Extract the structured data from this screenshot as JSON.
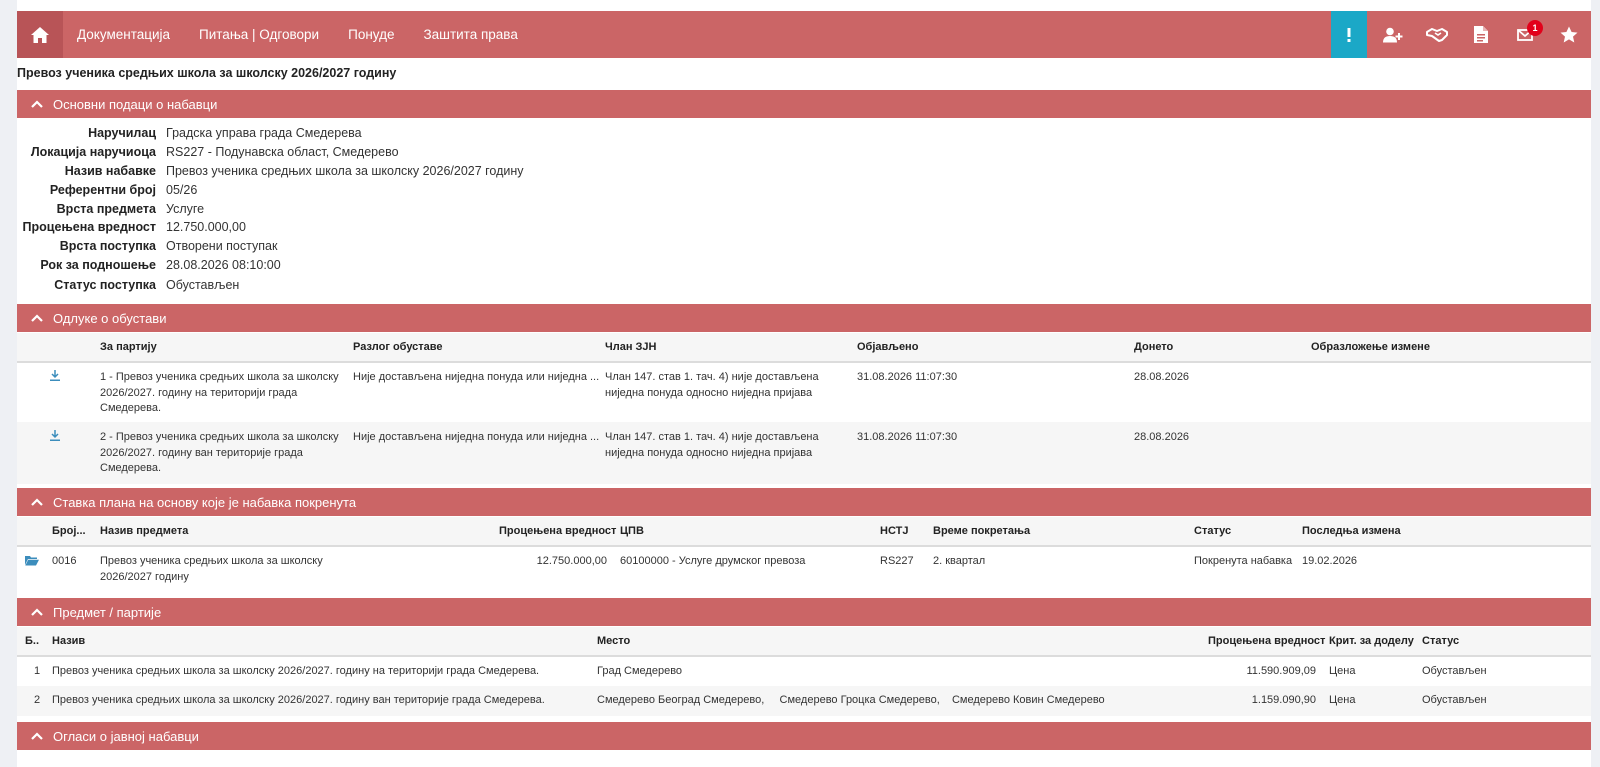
{
  "nav": {
    "items": [
      "Документација",
      "Питања | Одговори",
      "Понуде",
      "Заштита права"
    ],
    "badge_count": "1",
    "icons": [
      "home-icon",
      "exclamation-icon",
      "user-plus-icon",
      "handshake-icon",
      "document-icon",
      "envelope-icon",
      "star-icon"
    ]
  },
  "page_title": "Превоз ученика средњих школа за школску 2026/2027 годину",
  "basic": {
    "header": "Основни подаци о набавци",
    "rows": [
      {
        "label": "Наручилац",
        "value": "Градска управа града Смедерева"
      },
      {
        "label": "Локација наручиоца",
        "value": "RS227 - Подунавска област, Смедерево"
      },
      {
        "label": "Назив набавке",
        "value": "Превоз ученика средњих школа за школску 2026/2027 годину"
      },
      {
        "label": "Референтни број",
        "value": "05/26"
      },
      {
        "label": "Врста предмета",
        "value": "Услуге"
      },
      {
        "label": "Процењена вредност",
        "value": "12.750.000,00"
      },
      {
        "label": "Врста поступка",
        "value": "Отворени поступак"
      },
      {
        "label": "Рок за подношење",
        "value": "28.08.2026 08:10:00"
      },
      {
        "label": "Статус поступка",
        "value": "Обустављен"
      }
    ]
  },
  "decisions": {
    "header": "Одлуке о обустави",
    "columns": [
      "За партију",
      "Разлог обуставе",
      "Члан ЗЈН",
      "Објављено",
      "Донето",
      "Образложење измене"
    ],
    "rows": [
      {
        "lot": [
          "1 - Превоз ученика  средњих школа за школску",
          "2026/2027. годину на територији града",
          "Смедерева."
        ],
        "reason": "Није достављена ниједна понуда или ниједна ...",
        "article": [
          "Члан 147. став 1. тач. 4) није достављена",
          "ниједна понуда односно ниједна пријава"
        ],
        "published": "31.08.2026 11:07:30",
        "adopted": "28.08.2026"
      },
      {
        "lot": [
          "2 - Превоз ученика  средњих школа за школску",
          "2026/2027. годину ван територије града",
          "Смедерева."
        ],
        "reason": "Није достављена ниједна понуда или ниједна ...",
        "article": [
          "Члан 147. став 1. тач. 4) није достављена",
          "ниједна понуда односно ниједна пријава"
        ],
        "published": "31.08.2026 11:07:30",
        "adopted": "28.08.2026"
      }
    ]
  },
  "plan": {
    "header": "Ставка плана на основу које је набавка покренута",
    "columns": [
      "Број...",
      "Назив предмета",
      "Процењена вредност",
      "ЦПВ",
      "НСТЈ",
      "Време покретања",
      "Статус",
      "Последња измена"
    ],
    "row": {
      "number": "0016",
      "name": [
        "Превоз ученика средњих школа за школску",
        "2026/2027 годину"
      ],
      "value": "12.750.000,00",
      "cpv": "60100000 - Услуге друмског превоза",
      "nstj": "RS227",
      "start": "2. квартал",
      "status": "Покренута набавка",
      "modified": "19.02.2026"
    }
  },
  "lots": {
    "header": "Предмет / партије",
    "columns": [
      "Б..",
      "Назив",
      "Место",
      "Процењена вредност",
      "Крит. за доделу",
      "Статус"
    ],
    "rows": [
      {
        "no": "1",
        "name": "Превоз ученика  средњих школа за школску 2026/2027. годину на територији града Смедерева.",
        "place": "Град Смедерево",
        "value": "11.590.909,09",
        "criteria": "Цена",
        "status": "Обустављен"
      },
      {
        "no": "2",
        "name": "Превоз ученика  средњих школа за школску 2026/2027. годину ван територије града Смедерева.",
        "place": "Смедерево Београд Смедерево,     Смедерево Гроцка Смедерево,    Смедерево Ковин Смедерево",
        "value": "1.159.090,90",
        "criteria": "Цена",
        "status": "Обустављен"
      }
    ]
  },
  "ads": {
    "header": "Огласи о јавној набавци"
  },
  "colors": {
    "header": "#cb6566",
    "home": "#b85457",
    "alert": "#1ba8c7",
    "icon_blue": "#3c8dbc"
  }
}
